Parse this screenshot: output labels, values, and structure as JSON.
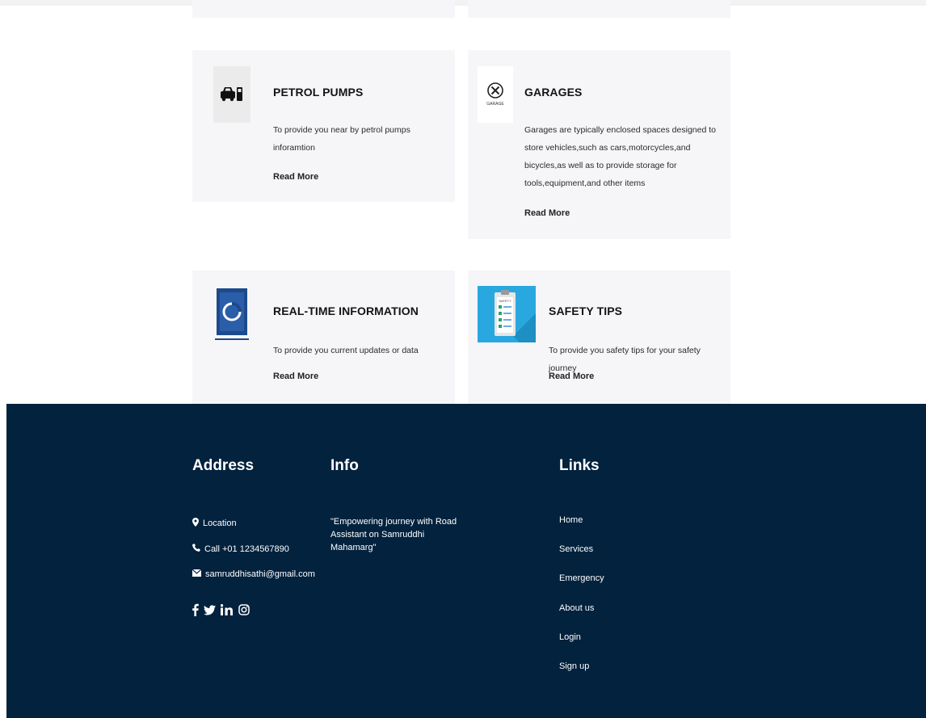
{
  "cards": [
    {
      "icon": "petrol-pump-car-icon",
      "title": "PETROL PUMPS",
      "description": "To provide you near by petrol pumps inforamtion",
      "more": "Read More"
    },
    {
      "icon": "garage-badge-icon",
      "title": "GARAGES",
      "description": "Garages are typically enclosed spaces designed to store vehicles,such as cars,motorcycles,and bicycles,as well as to provide storage for tools,equipment,and other items",
      "more": "Read More",
      "icon_caption": "GARAGE"
    },
    {
      "icon": "real-time-info-icon",
      "title": "REAL-TIME INFORMATION",
      "description": "To provide you current updates or data",
      "more": "Read More"
    },
    {
      "icon": "safety-clipboard-icon",
      "title": "SAFETY TIPS",
      "description": "To provide you safety tips for your safety journey",
      "more": "Read More",
      "icon_caption": "SAFETY"
    }
  ],
  "footer": {
    "address": {
      "heading": "Address",
      "location": "Location",
      "phone": "Call +01 1234567890",
      "email": "samruddhisathi@gmail.com"
    },
    "info": {
      "heading": "Info",
      "text": "\"Empowering journey with Road Assistant on Samruddhi Mahamarg\""
    },
    "links": {
      "heading": "Links",
      "items": [
        "Home",
        "Services",
        "Emergency",
        "About us",
        "Login",
        "Sign up"
      ]
    },
    "socials": [
      "facebook-icon",
      "twitter-icon",
      "linkedin-icon",
      "instagram-icon"
    ]
  },
  "colors": {
    "footer_bg": "#02223e",
    "card_bg": "#f6f6f8",
    "safety_icon_bg": "#29a8e0",
    "realtime_icon_bg": "#1c4a8c"
  }
}
